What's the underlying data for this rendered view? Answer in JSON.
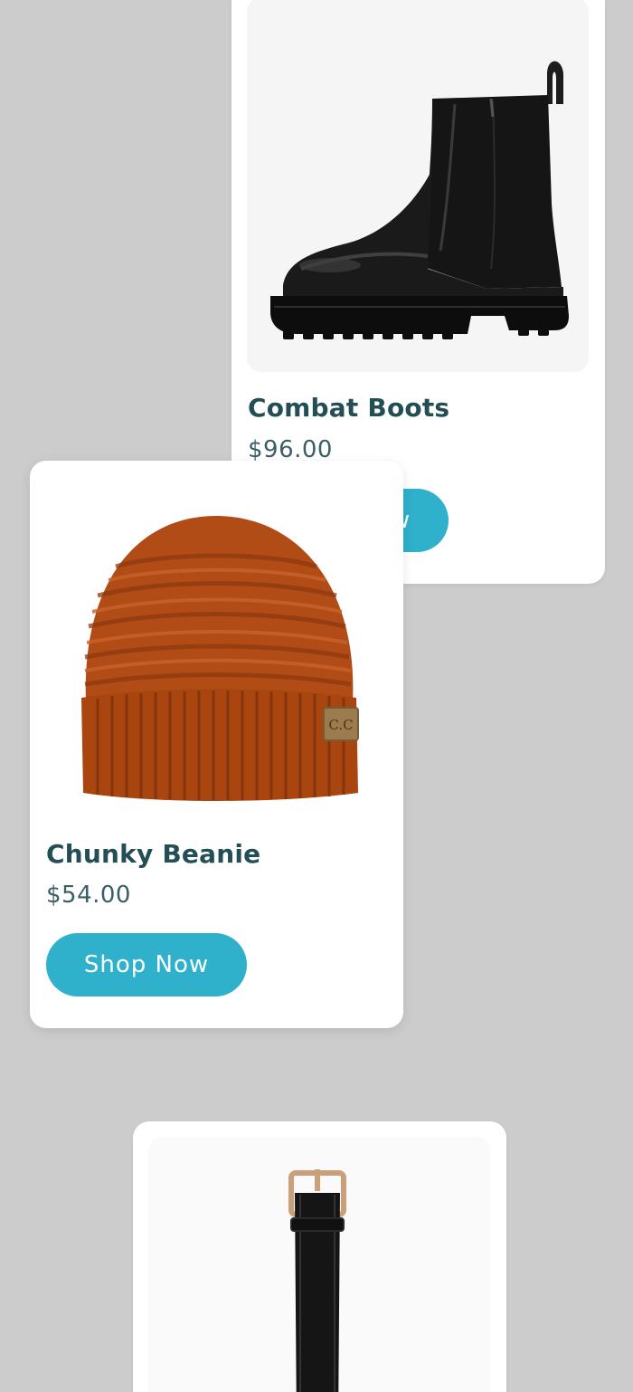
{
  "products": [
    {
      "title": "Combat Boots",
      "price": "$96.00",
      "button_label": "Shop Now",
      "image_icon": "boot-image"
    },
    {
      "title": "Chunky Beanie",
      "price": "$54.00",
      "button_label": "Shop Now",
      "image_icon": "beanie-image"
    },
    {
      "title": "",
      "price": "",
      "button_label": "",
      "image_icon": "watch-image"
    }
  ],
  "colors": {
    "background": "#cccccc",
    "card": "#ffffff",
    "title": "#234e55",
    "price": "#3a5f66",
    "button": "#2fb0cb",
    "button_text": "#ffffff",
    "beanie": "#b24c17",
    "boot": "#111111"
  }
}
